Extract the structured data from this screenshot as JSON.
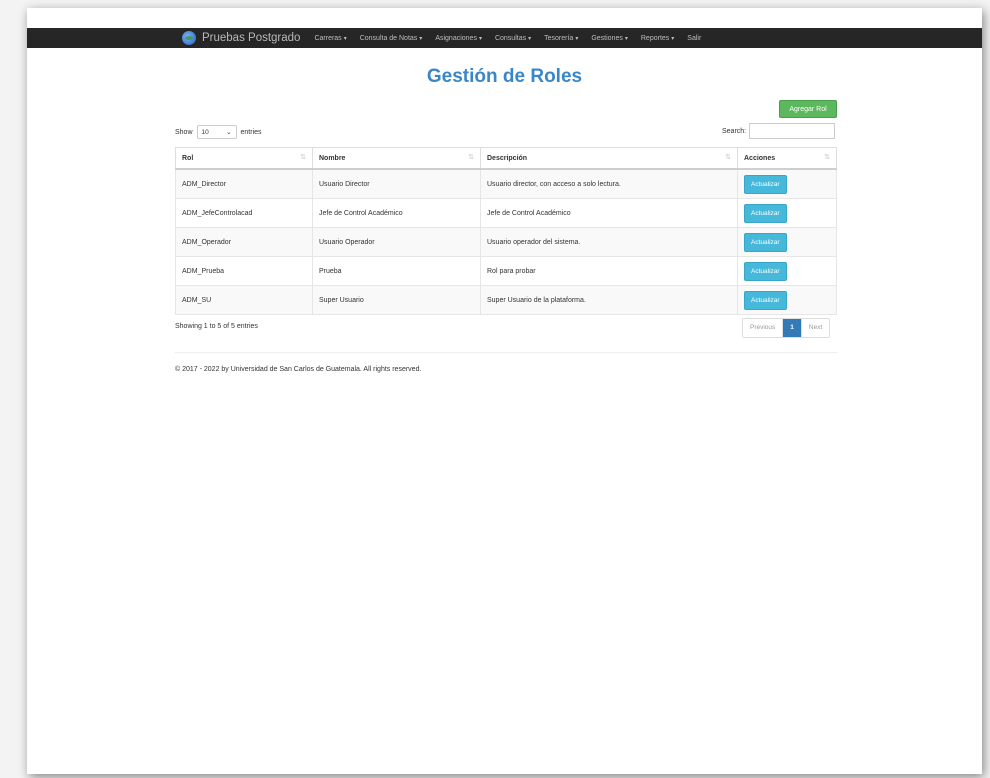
{
  "navbar": {
    "brand": "Pruebas Postgrado",
    "items": [
      {
        "label": "Carreras",
        "dropdown": true
      },
      {
        "label": "Consulta de Notas",
        "dropdown": true
      },
      {
        "label": "Asignaciones",
        "dropdown": true
      },
      {
        "label": "Consultas",
        "dropdown": true
      },
      {
        "label": "Tesorería",
        "dropdown": true
      },
      {
        "label": "Gestiones",
        "dropdown": true
      },
      {
        "label": "Reportes",
        "dropdown": true
      },
      {
        "label": "Salir",
        "dropdown": false
      }
    ]
  },
  "page": {
    "title": "Gestión de Roles"
  },
  "toolbar": {
    "add_label": "Agregar Rol"
  },
  "length": {
    "show_label": "Show",
    "value": "10",
    "entries_label": "entries"
  },
  "search": {
    "label": "Search:",
    "value": ""
  },
  "table": {
    "headers": [
      "Rol",
      "Nombre",
      "Descripción",
      "Acciones"
    ],
    "rows": [
      {
        "rol": "ADM_Director",
        "nombre": "Usuario Director",
        "descripcion": "Usuario director, con acceso a solo lectura.",
        "action": "Actualizar"
      },
      {
        "rol": "ADM_JefeControlacad",
        "nombre": "Jefe de Control Académico",
        "descripcion": "Jefe de Control Académico",
        "action": "Actualizar"
      },
      {
        "rol": "ADM_Operador",
        "nombre": "Usuario Operador",
        "descripcion": "Usuario operador del sistema.",
        "action": "Actualizar"
      },
      {
        "rol": "ADM_Prueba",
        "nombre": "Prueba",
        "descripcion": "Rol para probar",
        "action": "Actualizar"
      },
      {
        "rol": "ADM_SU",
        "nombre": "Super Usuario",
        "descripcion": "Super Usuario de la plataforma.",
        "action": "Actualizar"
      }
    ]
  },
  "info": "Showing 1 to 5 of 5 entries",
  "pagination": {
    "previous": "Previous",
    "current": "1",
    "next": "Next"
  },
  "footer": "© 2017 - 2022 by Universidad de San Carlos de Guatemala. All rights reserved.",
  "colors": {
    "navbar": "#262626",
    "title": "#3a87c7",
    "add_button": "#5cb85c",
    "update_button": "#46b8da",
    "page_active": "#337ab7"
  }
}
